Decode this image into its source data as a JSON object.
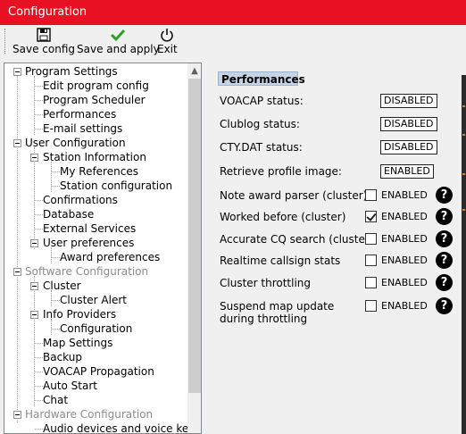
{
  "window": {
    "title": "Configuration"
  },
  "toolbar": {
    "save_config": "Save config",
    "save_and_apply": "Save and apply",
    "exit": "Exit"
  },
  "tree": {
    "program_settings": "Program Settings",
    "edit_program_config": "Edit program config",
    "program_scheduler": "Program Scheduler",
    "performances": "Performances",
    "email_settings": "E-mail settings",
    "user_configuration": "User Configuration",
    "station_information": "Station Information",
    "my_references": "My References",
    "station_configuration": "Station configuration",
    "confirmations": "Confirmations",
    "database": "Database",
    "external_services": "External Services",
    "user_preferences": "User preferences",
    "award_preferences": "Award preferences",
    "software_configuration": "Software Configuration",
    "cluster": "Cluster",
    "cluster_alert": "Cluster Alert",
    "info_providers": "Info Providers",
    "configuration": "Configuration",
    "map_settings": "Map Settings",
    "backup": "Backup",
    "voacap_propagation": "VOACAP Propagation",
    "auto_start": "Auto Start",
    "chat": "Chat",
    "hardware_configuration": "Hardware Configuration",
    "audio_devices": "Audio devices and voice keye"
  },
  "panel": {
    "title": "Performances",
    "voacap_label": "VOACAP status:",
    "voacap_status": "DISABLED",
    "clublog_label": "Clublog status:",
    "clublog_status": "DISABLED",
    "ctydat_label": "CTY.DAT status:",
    "ctydat_status": "DISABLED",
    "profile_label": "Retrieve profile image:",
    "profile_status": "ENABLED",
    "options": [
      {
        "label": "Note award parser (cluster)",
        "checked": false,
        "state": "ENABLED"
      },
      {
        "label": "Worked before (cluster)",
        "checked": true,
        "state": "ENABLED"
      },
      {
        "label": "Accurate CQ search (cluster)",
        "checked": false,
        "state": "ENABLED"
      },
      {
        "label": "Realtime callsign stats",
        "checked": false,
        "state": "ENABLED"
      },
      {
        "label": "Cluster throttling",
        "checked": false,
        "state": "ENABLED"
      },
      {
        "label_line1": "Suspend map update",
        "label_line2": "during throttling",
        "checked": false,
        "state": "ENABLED"
      }
    ],
    "help_glyph": "?"
  },
  "icons": {
    "save": "floppy-disk-icon",
    "apply": "checkmark-icon",
    "exit": "power-icon",
    "help": "question-circle-icon"
  }
}
